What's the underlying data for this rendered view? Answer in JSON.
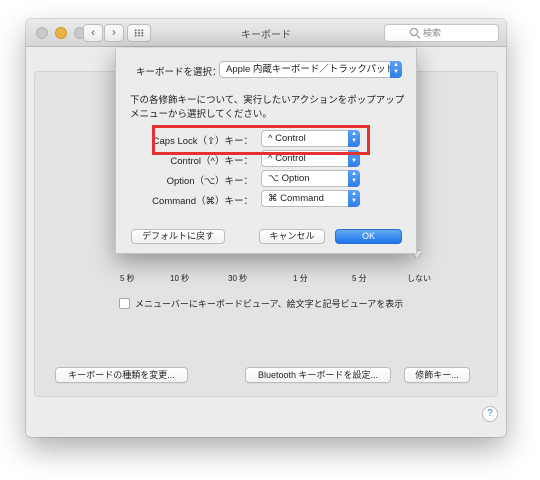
{
  "window": {
    "title": "キーボード",
    "search_placeholder": "検索",
    "nav_back": "‹",
    "nav_forward": "›"
  },
  "sheet": {
    "keyboard_select_label": "キーボードを選択：",
    "keyboard_select_value": "Apple 内蔵キーボード／トラックパッド",
    "description": "下の各修飾キーについて、実行したいアクションをポップアップメニューから選択してください。",
    "modifiers": [
      {
        "label": "Caps Lock（⇪）キー：",
        "value": "^ Control"
      },
      {
        "label": "Control（^）キー：",
        "value": "^ Control"
      },
      {
        "label": "Option（⌥）キー：",
        "value": "⌥ Option"
      },
      {
        "label": "Command（⌘）キー：",
        "value": "⌘ Command"
      }
    ],
    "buttons": {
      "defaults": "デフォルトに戻す",
      "cancel": "キャンセル",
      "ok": "OK"
    }
  },
  "background": {
    "slider_ticks": [
      "5 秒",
      "10 秒",
      "30 秒",
      "1 分",
      "5 分",
      "しない"
    ],
    "checkbox_label": "メニューバーにキーボードビューア、絵文字と記号ビューアを表示",
    "checkbox_checked": false,
    "buttons": {
      "change_type": "キーボードの種類を変更...",
      "bluetooth": "Bluetooth キーボードを設定...",
      "modifier_keys": "修飾キー..."
    },
    "help": "?"
  },
  "colors": {
    "highlight": "#e23232",
    "accent": "#2f7ee8"
  }
}
